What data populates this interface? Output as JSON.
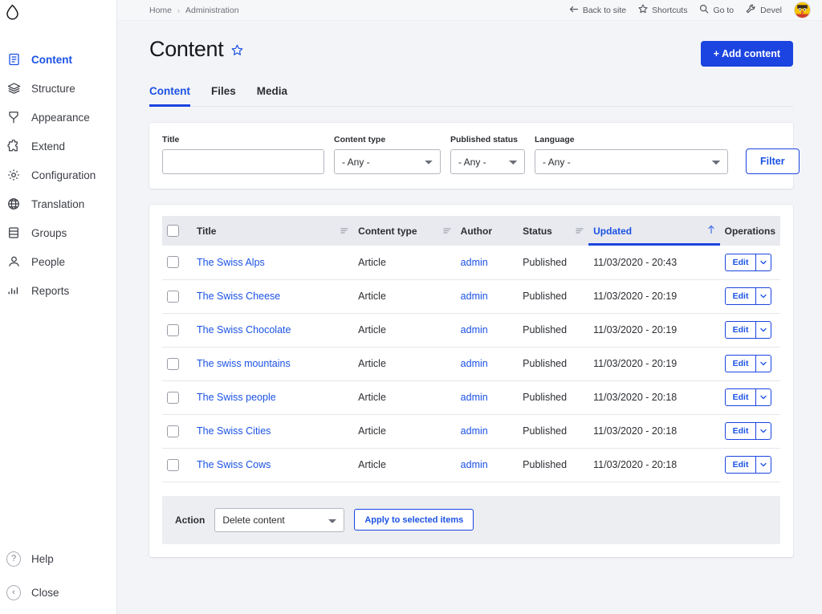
{
  "sidebar": {
    "logo_name": "drupal-droplet-logo",
    "items": [
      {
        "label": "Content",
        "icon": "document-icon",
        "active": true
      },
      {
        "label": "Structure",
        "icon": "layers-icon",
        "active": false
      },
      {
        "label": "Appearance",
        "icon": "paintbrush-icon",
        "active": false
      },
      {
        "label": "Extend",
        "icon": "puzzle-icon",
        "active": false
      },
      {
        "label": "Configuration",
        "icon": "gear-icon",
        "active": false
      },
      {
        "label": "Translation",
        "icon": "globe-icon",
        "active": false
      },
      {
        "label": "Groups",
        "icon": "database-icon",
        "active": false
      },
      {
        "label": "People",
        "icon": "person-icon",
        "active": false
      },
      {
        "label": "Reports",
        "icon": "bar-chart-icon",
        "active": false
      }
    ],
    "bottom": [
      {
        "label": "Help",
        "icon": "question-circle-icon"
      },
      {
        "label": "Close",
        "icon": "chevron-left-circle-icon"
      }
    ]
  },
  "topbar": {
    "breadcrumb": [
      "Home",
      "Administration"
    ],
    "separator": "›",
    "links": [
      {
        "label": "Back to site",
        "icon": "arrow-left-icon"
      },
      {
        "label": "Shortcuts",
        "icon": "star-icon"
      },
      {
        "label": "Go to",
        "icon": "search-icon"
      },
      {
        "label": "Devel",
        "icon": "wrench-icon"
      }
    ],
    "avatar_name": "user-avatar"
  },
  "header": {
    "title": "Content",
    "star_icon": "star-outline-icon",
    "add_button": "+ Add content"
  },
  "tabs": [
    {
      "label": "Content",
      "active": true
    },
    {
      "label": "Files",
      "active": false
    },
    {
      "label": "Media",
      "active": false
    }
  ],
  "filters": {
    "title": {
      "label": "Title",
      "value": "",
      "placeholder": ""
    },
    "content_type": {
      "label": "Content type",
      "value": "- Any -"
    },
    "published_status": {
      "label": "Published status",
      "value": "- Any -"
    },
    "language": {
      "label": "Language",
      "value": "- Any -"
    },
    "filter_button": "Filter"
  },
  "table": {
    "columns": [
      {
        "key": "title",
        "label": "Title",
        "sortable": true,
        "sorted": false
      },
      {
        "key": "type",
        "label": "Content type",
        "sortable": true,
        "sorted": false
      },
      {
        "key": "author",
        "label": "Author",
        "sortable": false,
        "sorted": false
      },
      {
        "key": "status",
        "label": "Status",
        "sortable": true,
        "sorted": false
      },
      {
        "key": "updated",
        "label": "Updated",
        "sortable": true,
        "sorted": true,
        "direction": "asc"
      },
      {
        "key": "ops",
        "label": "Operations",
        "sortable": false,
        "sorted": false
      }
    ],
    "rows": [
      {
        "title": "The Swiss Alps",
        "type": "Article",
        "author": "admin",
        "status": "Published",
        "updated": "11/03/2020 - 20:43",
        "op": "Edit"
      },
      {
        "title": "The Swiss Cheese",
        "type": "Article",
        "author": "admin",
        "status": "Published",
        "updated": "11/03/2020 - 20:19",
        "op": "Edit"
      },
      {
        "title": "The Swiss Chocolate",
        "type": "Article",
        "author": "admin",
        "status": "Published",
        "updated": "11/03/2020 - 20:19",
        "op": "Edit"
      },
      {
        "title": "The swiss mountains",
        "type": "Article",
        "author": "admin",
        "status": "Published",
        "updated": "11/03/2020 - 20:19",
        "op": "Edit"
      },
      {
        "title": "The Swiss people",
        "type": "Article",
        "author": "admin",
        "status": "Published",
        "updated": "11/03/2020 - 20:18",
        "op": "Edit"
      },
      {
        "title": "The Swiss Cities",
        "type": "Article",
        "author": "admin",
        "status": "Published",
        "updated": "11/03/2020 - 20:18",
        "op": "Edit"
      },
      {
        "title": "The Swiss Cows",
        "type": "Article",
        "author": "admin",
        "status": "Published",
        "updated": "11/03/2020 - 20:18",
        "op": "Edit"
      }
    ]
  },
  "action_bar": {
    "label": "Action",
    "select_value": "Delete content",
    "apply_button": "Apply to selected items"
  },
  "colors": {
    "accent": "#1b44e0",
    "accent_text": "#1b52e5",
    "page_bg": "#f3f4f7",
    "card_bg": "#ffffff",
    "thead_bg": "#e9eaef",
    "actionbar_bg": "#eceef2"
  }
}
